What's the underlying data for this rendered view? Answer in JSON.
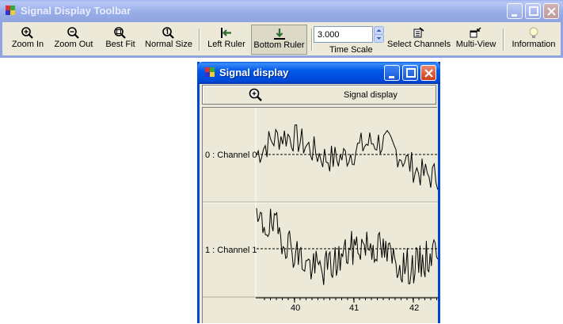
{
  "toolbar_window": {
    "title": "Signal Display Toolbar",
    "buttons": [
      {
        "label": "Zoom In",
        "icon": "zoom-in-icon"
      },
      {
        "label": "Zoom Out",
        "icon": "zoom-out-icon"
      },
      {
        "label": "Best Fit",
        "icon": "best-fit-icon"
      },
      {
        "label": "Normal Size",
        "icon": "normal-size-icon"
      },
      {
        "label": "Left Ruler",
        "icon": "left-ruler-icon"
      },
      {
        "label": "Bottom Ruler",
        "icon": "bottom-ruler-icon",
        "pressed": true
      },
      {
        "label": "Select Channels",
        "icon": "select-channels-icon"
      },
      {
        "label": "Multi-View",
        "icon": "multi-view-icon"
      },
      {
        "label": "Information",
        "icon": "information-icon"
      }
    ],
    "time_scale": {
      "value": "3.000",
      "label": "Time Scale"
    }
  },
  "signal_window": {
    "title": "Signal display",
    "header_label": "Signal display",
    "channels": [
      {
        "label": "0 : Channel 0"
      },
      {
        "label": "1 : Channel 1"
      }
    ],
    "x_ticks": [
      "40",
      "41",
      "42"
    ]
  },
  "colors": {
    "title_active": "#0258e8",
    "title_inactive": "#9aaee8",
    "face": "#ece9d8",
    "close_button": "#cf3c1a"
  }
}
